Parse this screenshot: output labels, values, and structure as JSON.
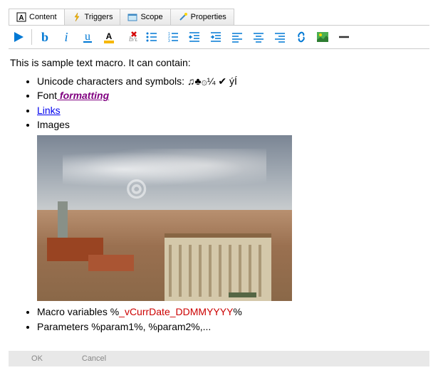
{
  "tabs": {
    "content": "Content",
    "triggers": "Triggers",
    "scope": "Scope",
    "properties": "Properties"
  },
  "content": {
    "intro": "This is sample text macro. It can contain:",
    "unicode_label": "Unicode characters and symbols: ",
    "unicode_symbols": "♫♣۞¼ ✔ ýÍ",
    "formatting_prefix": "Font",
    "formatting_styled": " formatting",
    "links_label": "Links",
    "images_label": "Images",
    "macro_prefix": "Macro variables %",
    "macro_var": "_vCurrDate_DDMMYYYY",
    "macro_suffix": "%",
    "params": "Parameters %param1%, %param2%,..."
  },
  "buttons": {
    "ok": "OK",
    "cancel": "Cancel"
  }
}
